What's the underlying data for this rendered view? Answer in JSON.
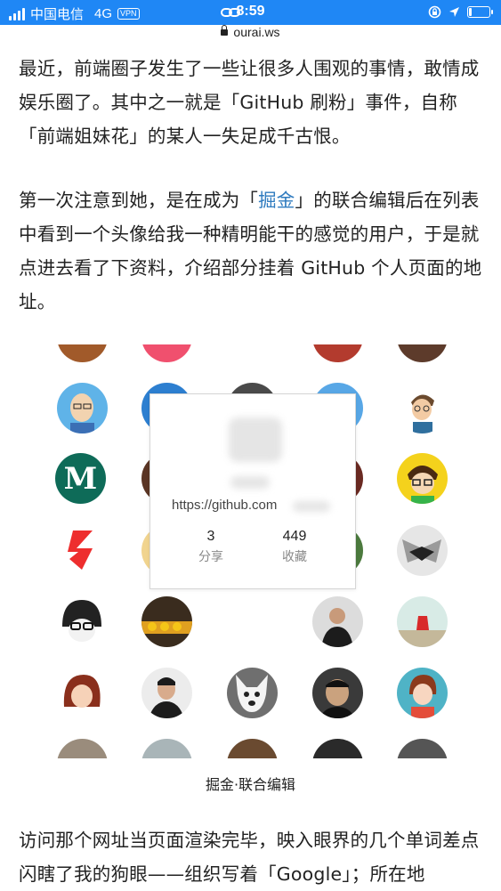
{
  "status_bar": {
    "carrier": "中国电信",
    "network": "4G",
    "vpn": "VPN",
    "time": "8:59"
  },
  "browser": {
    "domain": "ourai.ws"
  },
  "article": {
    "p1": "最近，前端圈子发生了一些让很多人围观的事情，敢情成娱乐圈了。其中之一就是「GitHub 刷粉」事件，自称「前端姐妹花」的某人一失足成千古恨。",
    "p2_before": "第一次注意到她，是在成为「",
    "p2_link": "掘金",
    "p2_after": "」的联合编辑后在列表中看到一个头像给我一种精明能干的感觉的用户，于是就点进去看了下资料，介绍部分挂着 GitHub 个人页面的地址。",
    "caption": "掘金·联合编辑",
    "p3": "访问那个网址当页面渲染完毕，映入眼界的几个单词差点闪瞎了我的狗眼——组织写着「Google」；所在地"
  },
  "profile_popup": {
    "url": "https://github.com",
    "stats": [
      {
        "value": "3",
        "label": "分享"
      },
      {
        "value": "449",
        "label": "收藏"
      }
    ]
  },
  "colors": {
    "status_bar": "#1f87f5",
    "link": "#2f7bbf"
  }
}
